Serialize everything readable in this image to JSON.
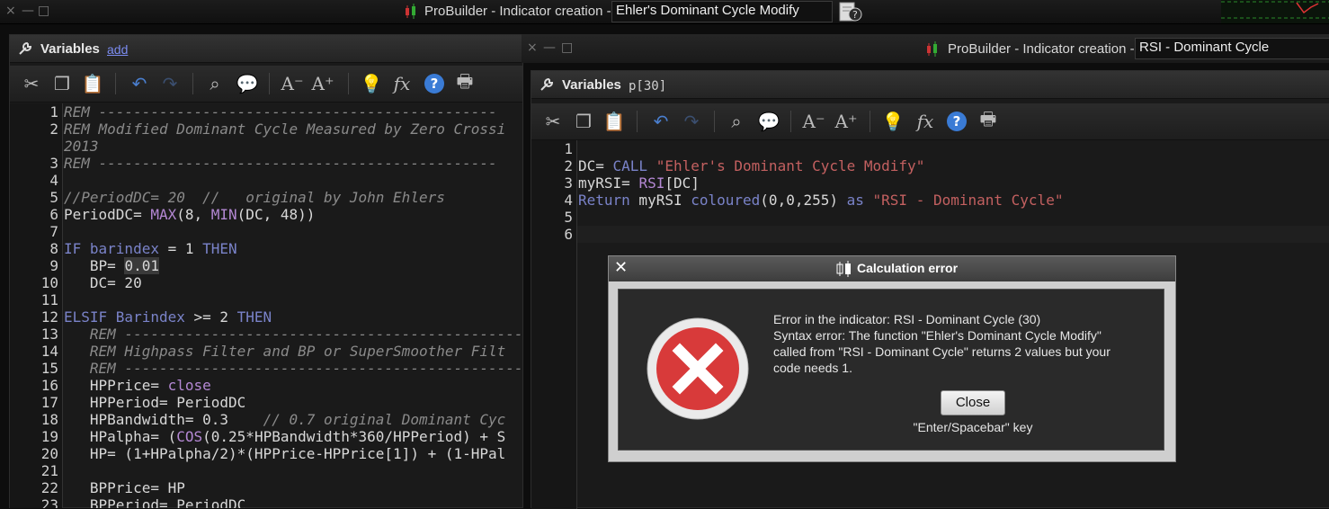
{
  "top_window": {
    "title": "ProBuilder - Indicator creation -",
    "indicator_name": "Ehler's Dominant Cycle Modify",
    "controls": [
      "×",
      "—",
      "□"
    ]
  },
  "left_window": {
    "variables_label": "Variables",
    "add_link": "add",
    "code_lines": [
      {
        "n": "1",
        "segs": [
          [
            "cm",
            "REM ----------------------------------------------"
          ]
        ]
      },
      {
        "n": "2",
        "segs": [
          [
            "cm",
            "REM Modified Dominant Cycle Measured by Zero Crossi"
          ]
        ]
      },
      {
        "n": "",
        "segs": [
          [
            "cm",
            "2013"
          ]
        ]
      },
      {
        "n": "3",
        "segs": [
          [
            "cm",
            "REM ----------------------------------------------"
          ]
        ]
      },
      {
        "n": "4",
        "segs": []
      },
      {
        "n": "5",
        "segs": [
          [
            "cm",
            "//PeriodDC= 20  //   original by John Ehlers"
          ]
        ]
      },
      {
        "n": "6",
        "segs": [
          [
            "id",
            "PeriodDC= "
          ],
          [
            "fn",
            "MAX"
          ],
          [
            "id",
            "(8, "
          ],
          [
            "fn",
            "MIN"
          ],
          [
            "id",
            "(DC, 48))"
          ]
        ]
      },
      {
        "n": "7",
        "segs": []
      },
      {
        "n": "8",
        "segs": [
          [
            "kw",
            "IF barindex"
          ],
          [
            "id",
            " = 1 "
          ],
          [
            "kw",
            "THEN"
          ]
        ]
      },
      {
        "n": "9",
        "segs": [
          [
            "id",
            "   BP= "
          ],
          [
            "hl",
            "0.01"
          ]
        ]
      },
      {
        "n": "10",
        "segs": [
          [
            "id",
            "   DC= 20"
          ]
        ]
      },
      {
        "n": "11",
        "segs": []
      },
      {
        "n": "12",
        "segs": [
          [
            "kw",
            "ELSIF Barindex"
          ],
          [
            "id",
            " >= 2 "
          ],
          [
            "kw",
            "THEN"
          ]
        ]
      },
      {
        "n": "13",
        "segs": [
          [
            "cm",
            "   REM ----------------------------------------------"
          ]
        ]
      },
      {
        "n": "14",
        "segs": [
          [
            "cm",
            "   REM Highpass Filter and BP or SuperSmoother Filt"
          ]
        ]
      },
      {
        "n": "15",
        "segs": [
          [
            "cm",
            "   REM ----------------------------------------------"
          ]
        ]
      },
      {
        "n": "16",
        "segs": [
          [
            "id",
            "   HPPrice= "
          ],
          [
            "fn",
            "close"
          ]
        ]
      },
      {
        "n": "17",
        "segs": [
          [
            "id",
            "   HPPeriod= PeriodDC"
          ]
        ]
      },
      {
        "n": "18",
        "segs": [
          [
            "id",
            "   HPBandwidth= 0.3    "
          ],
          [
            "cm",
            "// 0.7 original Dominant Cyc"
          ]
        ]
      },
      {
        "n": "19",
        "segs": [
          [
            "id",
            "   HPalpha= ("
          ],
          [
            "fn",
            "COS"
          ],
          [
            "id",
            "(0.25*HPBandwidth*360/HPPeriod) + S"
          ]
        ]
      },
      {
        "n": "20",
        "segs": [
          [
            "id",
            "   HP= (1+HPalpha/2)*(HPPrice-HPPrice[1]) + (1-HPal"
          ]
        ]
      },
      {
        "n": "21",
        "segs": []
      },
      {
        "n": "22",
        "segs": [
          [
            "id",
            "   BPPrice= HP"
          ]
        ]
      },
      {
        "n": "23",
        "segs": [
          [
            "id",
            "   BPPeriod= PeriodDC"
          ]
        ]
      }
    ]
  },
  "right_window": {
    "title": "ProBuilder - Indicator creation -",
    "indicator_name": "RSI - Dominant Cycle",
    "variables_label": "Variables",
    "variables_value": "p[30]",
    "code_lines": [
      {
        "n": "1",
        "segs": []
      },
      {
        "n": "2",
        "segs": [
          [
            "id",
            "DC= "
          ],
          [
            "kw",
            "CALL "
          ],
          [
            "st",
            "\"Ehler's Dominant Cycle Modify\""
          ]
        ]
      },
      {
        "n": "3",
        "segs": [
          [
            "id",
            "myRSI= "
          ],
          [
            "fn",
            "RSI"
          ],
          [
            "id",
            "[DC]"
          ]
        ]
      },
      {
        "n": "4",
        "segs": [
          [
            "kw",
            "Return"
          ],
          [
            "id",
            " myRSI "
          ],
          [
            "kw",
            "coloured"
          ],
          [
            "id",
            "(0,0,255) "
          ],
          [
            "kw",
            "as "
          ],
          [
            "st",
            "\"RSI - Dominant Cycle\""
          ]
        ]
      },
      {
        "n": "5",
        "segs": []
      },
      {
        "n": "6",
        "segs": []
      }
    ]
  },
  "dialog": {
    "title": "Calculation error",
    "line1": "Error in the indicator: RSI - Dominant Cycle (30)",
    "line2": "Syntax error: The function \"Ehler's Dominant Cycle Modify\"",
    "line3": "called from \"RSI - Dominant Cycle\" returns 2 values but your",
    "line4": "code needs 1.",
    "close_label": "Close",
    "hint": "\"Enter/Spacebar\" key"
  },
  "colors": {
    "comment": "#8a8a8a",
    "keyword": "#7a83c9",
    "function": "#b488d4",
    "string": "#c36060",
    "error_red": "#d83a3a"
  }
}
